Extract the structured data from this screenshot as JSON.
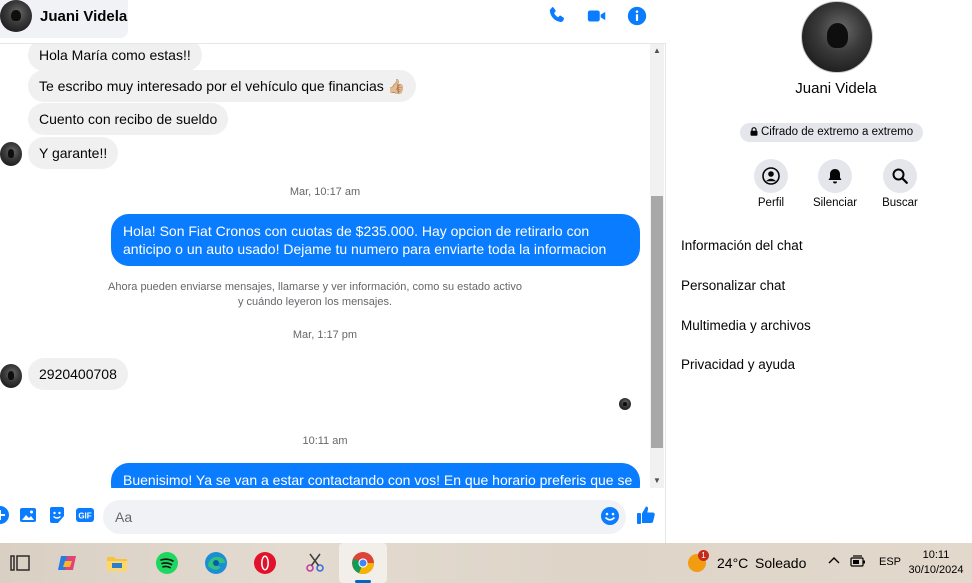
{
  "chat": {
    "contact_name": "Juani Videla",
    "messages": [
      {
        "dir": "in",
        "text": "Hola María como estas!!"
      },
      {
        "dir": "in",
        "text": "Te escribo muy interesado por el vehículo que financias 👍🏼"
      },
      {
        "dir": "in",
        "text": "Cuento con recibo de sueldo"
      },
      {
        "dir": "in",
        "text": "Y garante!!"
      },
      {
        "dir": "out",
        "text": "Hola! Son Fiat Cronos con cuotas de $235.000. Hay opcion de retirarlo con anticipo o un auto usado! Dejame tu numero para enviarte toda la informacion"
      },
      {
        "dir": "in",
        "text": "2920400708"
      },
      {
        "dir": "out",
        "text": "Buenisimo! Ya se van a estar contactando con vos! En que horario preferis que se"
      }
    ],
    "timestamps": [
      "Mar, 10:17 am",
      "Mar, 1:17 pm",
      "10:11 am"
    ],
    "system_note": "Ahora pueden enviarse mensajes, llamarse y ver información, como su estado activo y cuándo leyeron los mensajes.",
    "composer_placeholder": "Aa"
  },
  "info": {
    "name": "Juani Videla",
    "encryption": "Cifrado de extremo a extremo",
    "actions": [
      {
        "label": "Perfil",
        "icon": "profile-icon"
      },
      {
        "label": "Silenciar",
        "icon": "bell-icon"
      },
      {
        "label": "Buscar",
        "icon": "search-icon"
      }
    ],
    "menu": [
      "Información del chat",
      "Personalizar chat",
      "Multimedia y archivos",
      "Privacidad y ayuda"
    ]
  },
  "taskbar": {
    "weather_badge": "1",
    "temperature": "24°C",
    "condition": "Soleado",
    "language": "ESP",
    "time": "10:11",
    "date": "30/10/2024"
  },
  "colors": {
    "accent": "#0a7cff",
    "bubble_in": "#f0f0f0",
    "muted_text": "#65676b"
  }
}
